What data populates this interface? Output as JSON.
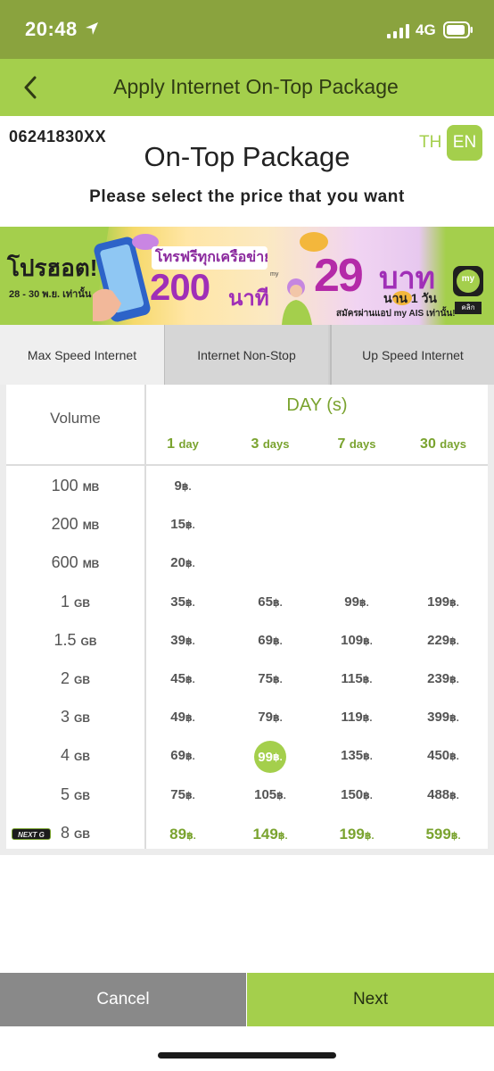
{
  "status_bar": {
    "time": "20:48",
    "network": "4G"
  },
  "header": {
    "title": "Apply Internet On-Top Package"
  },
  "info": {
    "phone_number": "06241830XX",
    "lang_th": "TH",
    "lang_en": "EN",
    "title": "On-Top Package",
    "subtitle": "Please select the price that you want"
  },
  "banner": {
    "hot_text": "โปรฮอต!",
    "dates": "28 - 30 พ.ย. เท่านั้น",
    "call_text": "โทรฟรีทุกเครือข่าย",
    "minutes_number": "200",
    "minutes_unit": "นาที",
    "my_small": "my",
    "price_number": "29",
    "price_unit": "บาท",
    "duration": "นาน 1 วัน",
    "via_app": "สมัครผ่านแอป my AIS เท่านั้น!",
    "app_icon_text": "my",
    "click_text": "คลิก"
  },
  "tabs": [
    {
      "label": "Max Speed Internet",
      "active": true
    },
    {
      "label": "Internet Non-Stop",
      "active": false
    },
    {
      "label": "Up Speed Internet",
      "active": false
    }
  ],
  "table": {
    "volume_header": "Volume",
    "day_header": "DAY (s)",
    "days": [
      {
        "num": "1",
        "unit": "day"
      },
      {
        "num": "3",
        "unit": "days"
      },
      {
        "num": "7",
        "unit": "days"
      },
      {
        "num": "30",
        "unit": "days"
      }
    ],
    "currency": "฿.",
    "nextg_badge": "NEXT G",
    "selected": {
      "row": 7,
      "col": 1
    },
    "rows": [
      {
        "num": "100",
        "unit": "MB",
        "prices": [
          "9",
          "",
          "",
          ""
        ]
      },
      {
        "num": "200",
        "unit": "MB",
        "prices": [
          "15",
          "",
          "",
          ""
        ]
      },
      {
        "num": "600",
        "unit": "MB",
        "prices": [
          "20",
          "",
          "",
          ""
        ]
      },
      {
        "num": "1",
        "unit": "GB",
        "prices": [
          "35",
          "65",
          "99",
          "199"
        ]
      },
      {
        "num": "1.5",
        "unit": "GB",
        "prices": [
          "39",
          "69",
          "109",
          "229"
        ]
      },
      {
        "num": "2",
        "unit": "GB",
        "prices": [
          "45",
          "75",
          "115",
          "239"
        ]
      },
      {
        "num": "3",
        "unit": "GB",
        "prices": [
          "49",
          "79",
          "119",
          "399"
        ]
      },
      {
        "num": "4",
        "unit": "GB",
        "prices": [
          "69",
          "99",
          "135",
          "450"
        ]
      },
      {
        "num": "5",
        "unit": "GB",
        "prices": [
          "75",
          "105",
          "150",
          "488"
        ]
      },
      {
        "num": "8",
        "unit": "GB",
        "prices": [
          "89",
          "149",
          "199",
          "599"
        ],
        "highlight": true,
        "nextg": true
      }
    ]
  },
  "buttons": {
    "cancel": "Cancel",
    "next": "Next"
  },
  "colors": {
    "brand_green": "#a4cf4c",
    "status_green": "#8aa33e",
    "price_green": "#7aa32f",
    "cancel_gray": "#898989"
  }
}
